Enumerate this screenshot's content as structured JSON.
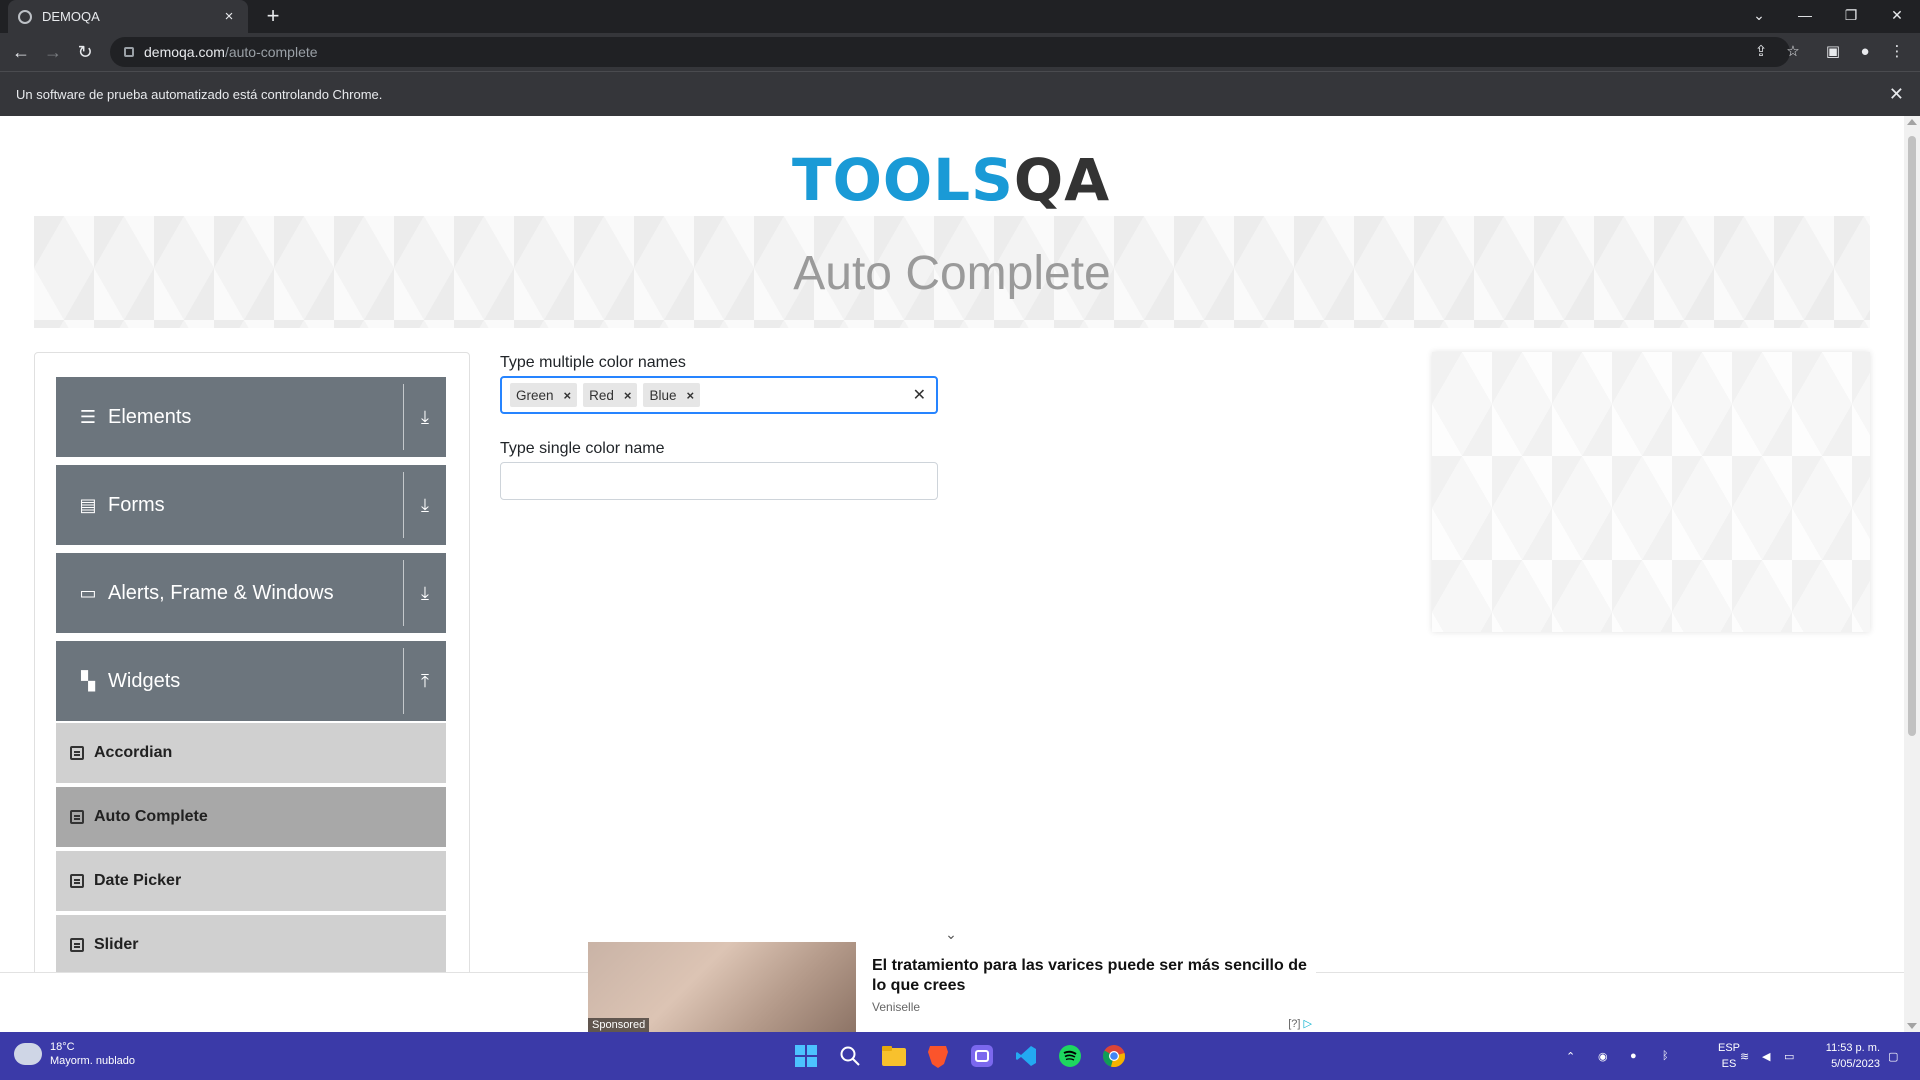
{
  "browser": {
    "tab_title": "DEMOQA",
    "tab_close": "×",
    "new_tab": "+",
    "url_host": "demoqa.com",
    "url_path": "/auto-complete",
    "infobar_text": "Un software de prueba automatizado está controlando Chrome.",
    "infobar_close": "✕"
  },
  "page": {
    "logo_tools": "TOOLS",
    "logo_qa": "QA",
    "title": "Auto Complete"
  },
  "sidebar": {
    "groups": [
      {
        "label": "Elements",
        "icon": "hamburger-icon"
      },
      {
        "label": "Forms",
        "icon": "document-icon"
      },
      {
        "label": "Alerts, Frame & Windows",
        "icon": "window-icon"
      },
      {
        "label": "Widgets",
        "icon": "widgets-icon"
      }
    ],
    "widget_items": [
      "Accordian",
      "Auto Complete",
      "Date Picker",
      "Slider"
    ],
    "active_item": "Auto Complete"
  },
  "form": {
    "multi_label": "Type multiple color names",
    "multi_values": [
      "Green",
      "Red",
      "Blue"
    ],
    "single_label": "Type single color name",
    "single_value": ""
  },
  "ad": {
    "headline": "El tratamiento para las varices puede ser más sencillo de lo que crees",
    "brand": "Veniselle",
    "sponsored": "Sponsored",
    "info": "[?]"
  },
  "taskbar": {
    "temperature": "18°C",
    "weather": "Mayorm. nublado",
    "lang_top": "ESP",
    "lang_bottom": "ES",
    "time": "11:53 p. m.",
    "date": "5/05/2023"
  },
  "colors": {
    "sidebar_header": "#6c757d",
    "focus_border": "#2684ff",
    "logo_blue": "#1a9ad6",
    "taskbar": "#3b3aa8"
  }
}
